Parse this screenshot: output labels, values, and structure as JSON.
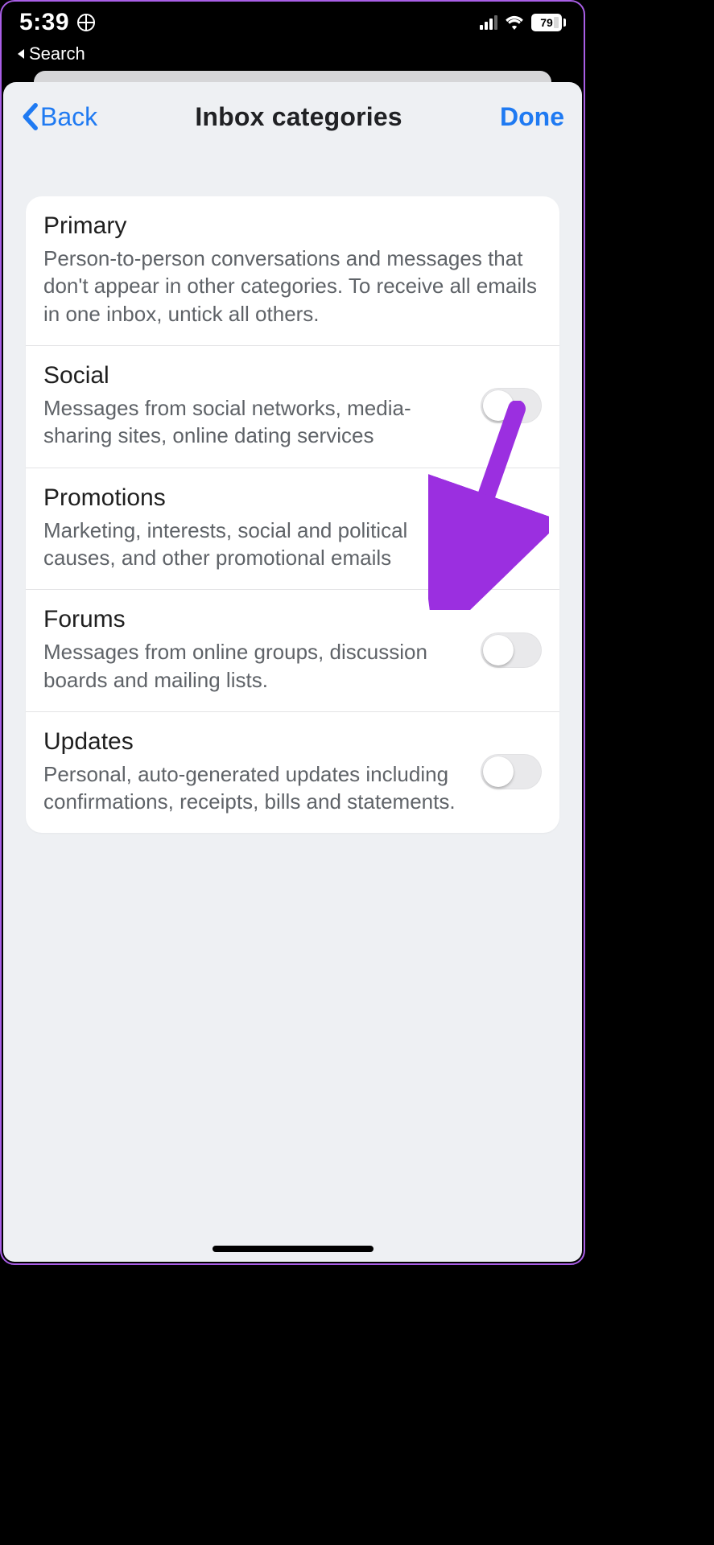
{
  "status": {
    "time": "5:39",
    "battery": "79"
  },
  "breadcrumb": {
    "label": "Search"
  },
  "nav": {
    "back": "Back",
    "title": "Inbox categories",
    "done": "Done"
  },
  "categories": [
    {
      "key": "primary",
      "title": "Primary",
      "desc": "Person-to-person conversations and messages that don't appear in other categories. To receive all emails in one inbox, untick all others.",
      "has_toggle": false,
      "on": false
    },
    {
      "key": "social",
      "title": "Social",
      "desc": "Messages from social networks, media-sharing sites, online dating services",
      "has_toggle": true,
      "on": false
    },
    {
      "key": "promotions",
      "title": "Promotions",
      "desc": "Marketing, interests, social and political causes, and other promotional emails",
      "has_toggle": true,
      "on": true
    },
    {
      "key": "forums",
      "title": "Forums",
      "desc": "Messages from online groups, discussion boards and mailing lists.",
      "has_toggle": true,
      "on": false
    },
    {
      "key": "updates",
      "title": "Updates",
      "desc": "Personal, auto-generated updates including confirmations, receipts, bills and statements.",
      "has_toggle": true,
      "on": false
    }
  ]
}
